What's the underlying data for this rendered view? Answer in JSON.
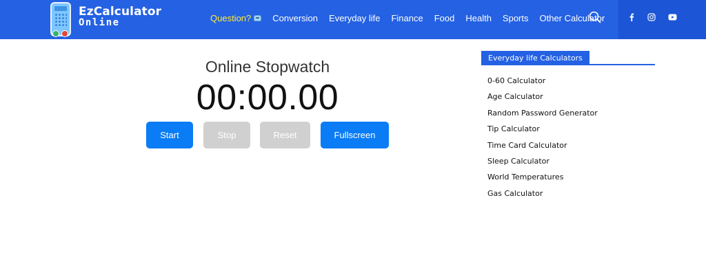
{
  "logo": {
    "line1": "EzCalculator",
    "line2": "Online",
    "icon": "calculator-icon"
  },
  "nav": {
    "question": "Question?",
    "question_icon": "robot-icon",
    "items": [
      "Conversion",
      "Everyday life",
      "Finance",
      "Food",
      "Health",
      "Sports",
      "Other Calculator"
    ],
    "search_icon": "search-icon"
  },
  "social": {
    "icons": [
      "facebook-icon",
      "instagram-icon",
      "youtube-icon"
    ]
  },
  "stopwatch": {
    "title": "Online Stopwatch",
    "time": "00:00.00",
    "buttons": {
      "start": "Start",
      "stop": "Stop",
      "reset": "Reset",
      "fullscreen": "Fullscreen"
    }
  },
  "sidebar": {
    "heading": "Everyday life Calculators",
    "items": [
      "0-60 Calculator",
      "Age Calculator",
      "Random Password Generator",
      "Tip Calculator",
      "Time Card Calculator",
      "Sleep Calculator",
      "World Temperatures",
      "Gas Calculator"
    ]
  },
  "colors": {
    "header": "#2461e3",
    "social_bar": "#1c55d6",
    "primary_button": "#0a7cf5",
    "disabled_button": "#d0d0d0",
    "question_accent": "#ffeb3b"
  }
}
